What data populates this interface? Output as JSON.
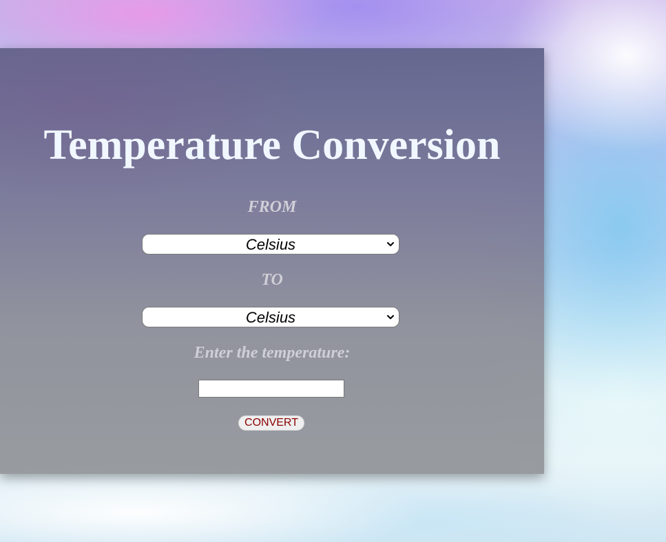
{
  "form": {
    "title": "Temperature Conversion",
    "from_label": "FROM",
    "from_select": {
      "selected": "Celsius"
    },
    "to_label": "TO",
    "to_select": {
      "selected": "Celsius"
    },
    "temp_label": "Enter the temperature:",
    "temp_input": {
      "value": "",
      "placeholder": ""
    },
    "convert_button": "CONVERT"
  },
  "colors": {
    "title": "#f1f7ff",
    "label": "#cfcfd8",
    "button_text": "#8b0000"
  },
  "icons": {
    "select_arrow": "chevron-down-icon"
  }
}
